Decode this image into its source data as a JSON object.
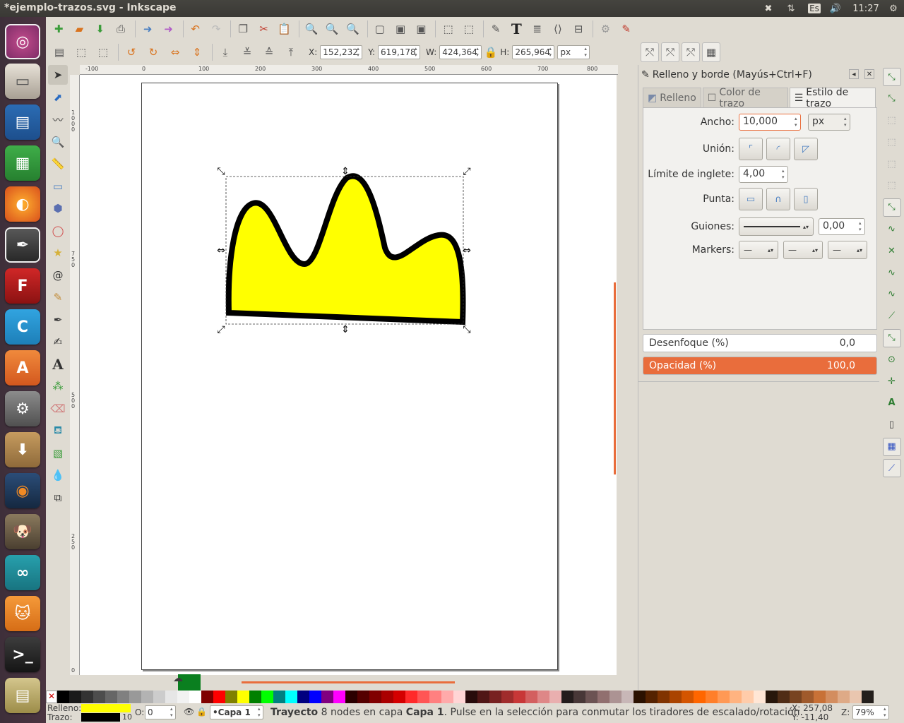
{
  "window": {
    "title": "*ejemplo-trazos.svg - Inkscape"
  },
  "system_tray": {
    "keyboard_layout": "Es",
    "time": "11:27",
    "icons": [
      "shuffle-icon",
      "network-icon",
      "keyboard-icon",
      "volume-icon",
      "settings-icon"
    ]
  },
  "launcher": {
    "apps": [
      "Ubuntu Dash",
      "Archivos",
      "LibreOffice Impress",
      "LibreOffice Calc",
      "Firefox",
      "Inkscape",
      "FontForge",
      "Chamilo",
      "Ubuntu Software Center",
      "System Settings",
      "Archive Manager",
      "Blender",
      "GIMP",
      "Arduino",
      "Scratch",
      "Terminal",
      "Document Viewer"
    ]
  },
  "toolbar_commands": [
    "new",
    "open",
    "save",
    "print",
    "import",
    "export",
    "undo",
    "redo",
    "duplicate",
    "cut",
    "copy",
    "paste",
    "zoom-selection",
    "zoom-drawing",
    "zoom-page",
    "group",
    "ungroup",
    "clip",
    "transform",
    "align",
    "xml-editor",
    "text",
    "layers",
    "fill-stroke",
    "object",
    "preferences",
    "document-properties"
  ],
  "selector_bar": {
    "x_label": "X:",
    "x_value": "152,232",
    "y_label": "Y:",
    "y_value": "619,178",
    "w_label": "W:",
    "w_value": "424,364",
    "h_label": "H:",
    "h_value": "265,964",
    "unit": "px"
  },
  "ruler": {
    "h_ticks": [
      "-100",
      "0",
      "100",
      "200",
      "300",
      "400",
      "500",
      "600",
      "700",
      "800"
    ],
    "v_ticks": [
      "1000",
      "750",
      "500",
      "250",
      "0"
    ]
  },
  "tools": [
    "selector",
    "node",
    "tweak",
    "zoom",
    "measure",
    "rectangle",
    "3dbox",
    "ellipse",
    "star",
    "spiral",
    "pencil",
    "pen",
    "calligraphy",
    "text",
    "spray",
    "eraser",
    "paint-bucket",
    "gradient",
    "dropper",
    "connector"
  ],
  "dialog": {
    "title": "Relleno y borde (Mayús+Ctrl+F)",
    "tabs": [
      "Relleno",
      "Color de trazo",
      "Estilo de trazo"
    ],
    "active_tab": "Estilo de trazo",
    "width_label": "Ancho:",
    "width_value": "10,000",
    "width_unit": "px",
    "join_label": "Unión:",
    "miter_label": "Límite de inglete:",
    "miter_value": "4,00",
    "cap_label": "Punta:",
    "dashes_label": "Guiones:",
    "dash_offset": "0,00",
    "markers_label": "Markers:",
    "blur_label": "Desenfoque (%)",
    "blur_value": "0,0",
    "opacity_label": "Opacidad (%)",
    "opacity_value": "100,0"
  },
  "drawing": {
    "fill": "#ffff00",
    "stroke": "#000000"
  },
  "status": {
    "fill_label": "Relleno:",
    "stroke_label": "Trazo:",
    "stroke_width": "10",
    "opacity_label": "O:",
    "opacity_value": "0",
    "layer": "•Capa 1",
    "msg_bold1": "Trayecto",
    "msg_1": " 8 nodes en capa ",
    "msg_bold2": "Capa 1",
    "msg_2": ". Pulse en la selección para conmutar los tiradores de escalado/rotación.",
    "cursor_x": "X:  257,08",
    "cursor_y": "Y:  -11,40",
    "zoom_label": "Z:",
    "zoom_value": "79%"
  },
  "colors": {
    "accent": "#e96d3c",
    "fill_yellow": "#ffff00"
  }
}
